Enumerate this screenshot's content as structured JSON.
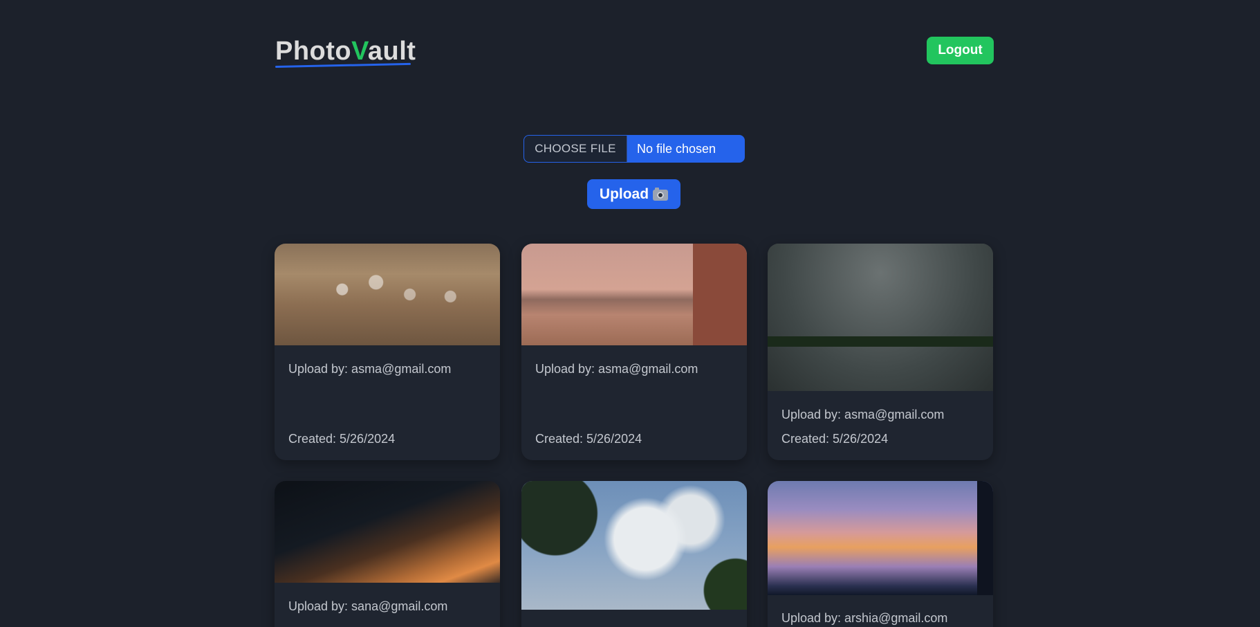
{
  "app": {
    "logo_part1": "Photo",
    "logo_part2": "V",
    "logo_part3": "ault",
    "logout_label": "Logout"
  },
  "uploader": {
    "choose_file_label": "CHOOSE FILE",
    "file_status": "No file chosen",
    "upload_label": "Upload",
    "upload_icon": "camera-icon"
  },
  "photos": [
    {
      "uploaded_by": "Upload by: asma@gmail.com",
      "created": "Created: 5/26/2024"
    },
    {
      "uploaded_by": "Upload by: asma@gmail.com",
      "created": "Created: 5/26/2024"
    },
    {
      "uploaded_by": "Upload by: asma@gmail.com",
      "created": "Created: 5/26/2024"
    },
    {
      "uploaded_by": "Upload by: sana@gmail.com"
    },
    {
      "uploaded_by": ""
    },
    {
      "uploaded_by": "Upload by: arshia@gmail.com"
    }
  ],
  "colors": {
    "background": "#1c212b",
    "card": "#1f2530",
    "accent_blue": "#2563eb",
    "accent_green": "#22c55e"
  }
}
